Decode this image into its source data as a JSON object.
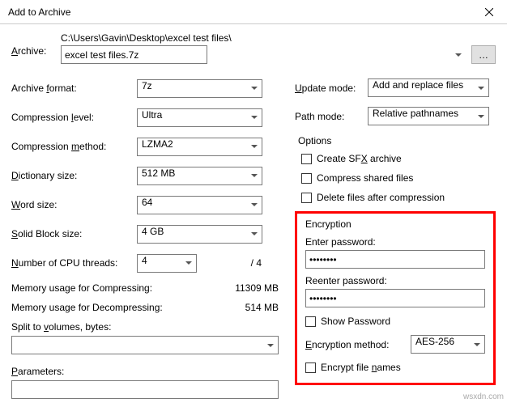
{
  "titlebar": {
    "title": "Add to Archive"
  },
  "archive": {
    "label": "Archive:",
    "path": "C:\\Users\\Gavin\\Desktop\\excel test files\\",
    "filename": "excel test files.7z",
    "browse": "…"
  },
  "left": {
    "format": {
      "label": "Archive format:",
      "value": "7z",
      "hotkey": "f"
    },
    "level": {
      "label": "Compression level:",
      "value": "Ultra",
      "hotkey": "l"
    },
    "method": {
      "label": "Compression method:",
      "value": "LZMA2",
      "hotkey": "m"
    },
    "dict": {
      "label": "Dictionary size:",
      "value": "512 MB",
      "hotkey": "D"
    },
    "word": {
      "label": "Word size:",
      "value": "64",
      "hotkey": "W"
    },
    "block": {
      "label": "Solid Block size:",
      "value": "4 GB",
      "hotkey": "S"
    },
    "threads": {
      "label": "Number of CPU threads:",
      "value": "4",
      "suffix": "/ 4",
      "hotkey": "N"
    },
    "mem_comp": {
      "label": "Memory usage for Compressing:",
      "value": "11309 MB"
    },
    "mem_decomp": {
      "label": "Memory usage for Decompressing:",
      "value": "514 MB"
    },
    "split": {
      "label": "Split to volumes, bytes:",
      "value": "",
      "hotkey": "v"
    },
    "params": {
      "label": "Parameters:",
      "value": "",
      "hotkey": "P"
    }
  },
  "right": {
    "update": {
      "label": "Update mode:",
      "value": "Add and replace files",
      "hotkey": "U"
    },
    "path": {
      "label": "Path mode:",
      "value": "Relative pathnames"
    },
    "options_title": "Options",
    "sfx": {
      "label": "Create SFX archive",
      "checked": false,
      "hotkey": "x"
    },
    "shared": {
      "label": "Compress shared files",
      "checked": false
    },
    "delete": {
      "label": "Delete files after compression",
      "checked": false
    },
    "encryption": {
      "title": "Encryption",
      "enter": {
        "label": "Enter password:",
        "value": "********"
      },
      "reenter": {
        "label": "Reenter password:",
        "value": "********"
      },
      "show": {
        "label": "Show Password",
        "checked": false
      },
      "method": {
        "label": "Encryption method:",
        "value": "AES-256",
        "hotkey": "E"
      },
      "encrypt_names": {
        "label": "Encrypt file names",
        "checked": false,
        "hotkey": "n"
      }
    }
  },
  "watermark": "wsxdn.com"
}
